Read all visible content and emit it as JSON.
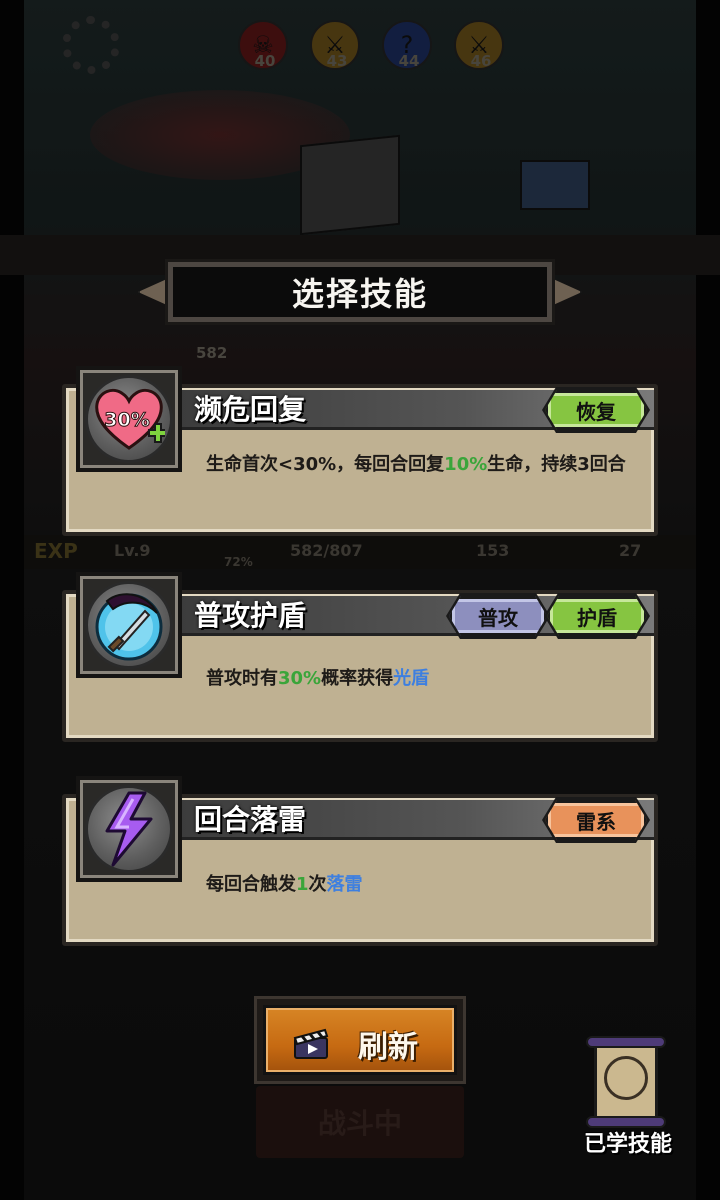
{
  "title": "选择技能",
  "top_counters": [
    {
      "icon": "skull-icon",
      "value": "40",
      "color": "#8c1f1f"
    },
    {
      "icon": "sword-icon",
      "value": "43",
      "color": "#a07a1e"
    },
    {
      "icon": "question-icon",
      "value": "44",
      "color": "#23408a"
    },
    {
      "icon": "sword-icon",
      "value": "46",
      "color": "#a07a1e"
    }
  ],
  "player": {
    "hp_display": "582"
  },
  "stats": {
    "exp_label": "EXP",
    "level": "Lv.9",
    "hp": "582/807",
    "hp_percent": "72%",
    "attack": "153",
    "defense": "27"
  },
  "skills": [
    {
      "name": "濒危回复",
      "icon": "heart-30-icon",
      "icon_text": "30%",
      "tags": [
        {
          "label": "恢复",
          "color": "#86c541"
        }
      ],
      "desc_parts": [
        "生命首次<30%，每回合回复",
        "10%",
        "生命，持续3回合"
      ]
    },
    {
      "name": "普攻护盾",
      "icon": "shield-sword-icon",
      "tags": [
        {
          "label": "普攻",
          "color": "#8d8fbe"
        },
        {
          "label": "护盾",
          "color": "#86c541"
        }
      ],
      "desc_parts": [
        "普攻时有",
        "30%",
        "概率获得",
        "光盾"
      ]
    },
    {
      "name": "回合落雷",
      "icon": "lightning-icon",
      "tags": [
        {
          "label": "雷系",
          "color": "#e8925b"
        }
      ],
      "desc_parts": [
        "每回合触发",
        "1",
        "次",
        "落雷"
      ]
    }
  ],
  "refresh_button": {
    "label": "刷新",
    "icon": "clapperboard-icon"
  },
  "battle_button": {
    "label": "战斗中"
  },
  "learned_skills": {
    "label": "已学技能",
    "icon": "scroll-icon"
  }
}
